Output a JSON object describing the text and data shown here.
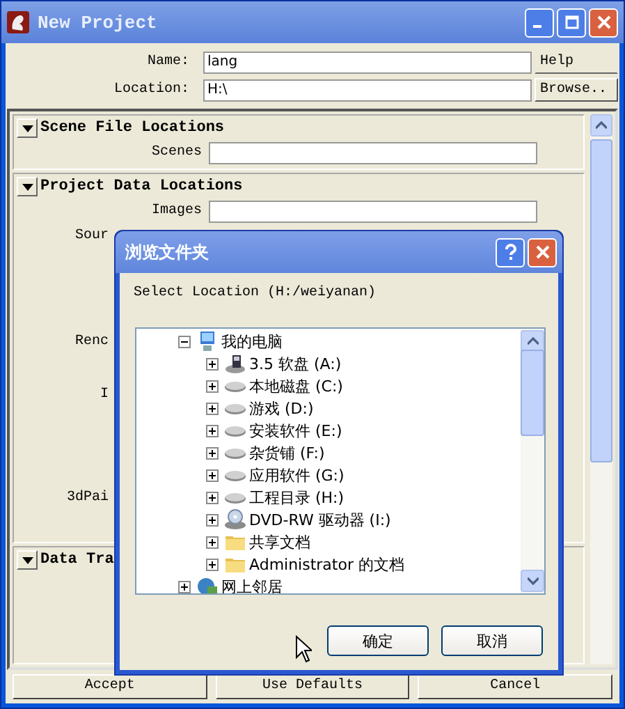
{
  "window": {
    "title": "New Project"
  },
  "name_field": {
    "label": "Name:",
    "value": "lang"
  },
  "location_field": {
    "label": "Location:",
    "value": "H:\\"
  },
  "help_button": "Help",
  "browse_button": "Browse..",
  "sections": [
    {
      "title": "Scene File Locations",
      "expanded": true,
      "rows": [
        {
          "kind": "field",
          "label": "Scenes"
        }
      ]
    },
    {
      "title": "Project Data Locations",
      "expanded": true,
      "rows": [
        {
          "kind": "field",
          "label": "Images"
        },
        {
          "kind": "covered",
          "label": "Sour"
        },
        {
          "kind": "covered",
          "label": "Renc"
        },
        {
          "kind": "covered",
          "label": "I"
        },
        {
          "kind": "covered",
          "label": "3dPai"
        }
      ]
    },
    {
      "title": "Data Tra",
      "expanded": true
    }
  ],
  "buttons": [
    "Accept",
    "Use Defaults",
    "Cancel"
  ],
  "dialog": {
    "title": "浏览文件夹",
    "prompt": "Select Location (H:/weiyanan)",
    "tree": [
      {
        "label": "我的电脑",
        "kind": "computer",
        "expanded": true,
        "children": [
          {
            "label": "3.5 软盘 (A:)",
            "kind": "floppy",
            "expanded": false
          },
          {
            "label": "本地磁盘 (C:)",
            "kind": "drive",
            "expanded": false
          },
          {
            "label": "游戏 (D:)",
            "kind": "drive",
            "expanded": false
          },
          {
            "label": "安装软件 (E:)",
            "kind": "drive",
            "expanded": false
          },
          {
            "label": "杂货铺 (F:)",
            "kind": "drive",
            "expanded": false
          },
          {
            "label": "应用软件 (G:)",
            "kind": "drive",
            "expanded": false
          },
          {
            "label": "工程目录 (H:)",
            "kind": "drive",
            "expanded": false
          },
          {
            "label": "DVD-RW 驱动器 (I:)",
            "kind": "dvd",
            "expanded": false
          },
          {
            "label": "共享文档",
            "kind": "folder",
            "expanded": false
          },
          {
            "label": "Administrator 的文档",
            "kind": "folder",
            "expanded": false
          }
        ]
      },
      {
        "label": "网上邻居",
        "kind": "network",
        "expanded": false
      }
    ],
    "buttons": [
      "确定",
      "取消"
    ]
  }
}
